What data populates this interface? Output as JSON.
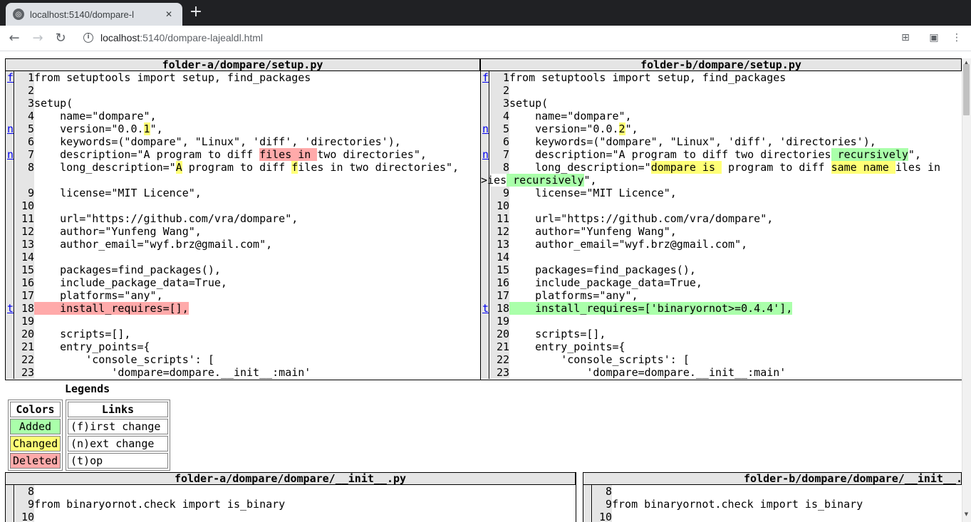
{
  "browser": {
    "tab_title": "localhost:5140/dompare-l",
    "tab_close": "✕",
    "new_tab": "+",
    "url_host": "localhost",
    "url_path": ":5140/dompare-lajealdl.html"
  },
  "diff1": {
    "left_title": "folder-a/dompare/setup.py",
    "right_title": "folder-b/dompare/setup.py",
    "left_rows": [
      {
        "lnk": "f",
        "n": "1",
        "segs": [
          {
            "t": "from setuptools import setup, find_packages"
          }
        ]
      },
      {
        "lnk": "",
        "n": "2",
        "segs": [
          {
            "t": ""
          }
        ]
      },
      {
        "lnk": "",
        "n": "3",
        "segs": [
          {
            "t": "setup("
          }
        ]
      },
      {
        "lnk": "",
        "n": "4",
        "segs": [
          {
            "t": "    name=\"dompare\","
          }
        ]
      },
      {
        "lnk": "n",
        "n": "5",
        "segs": [
          {
            "t": "    version=\"0.0."
          },
          {
            "t": "1",
            "c": "chg"
          },
          {
            "t": "\","
          }
        ]
      },
      {
        "lnk": "",
        "n": "6",
        "segs": [
          {
            "t": "    keywords=(\"dompare\", \"Linux\", 'diff', 'directories'),"
          }
        ]
      },
      {
        "lnk": "n",
        "n": "7",
        "segs": [
          {
            "t": "    description=\"A program to diff "
          },
          {
            "t": "files in ",
            "c": "del"
          },
          {
            "t": "two directories\","
          }
        ]
      },
      {
        "lnk": "",
        "n": "8",
        "segs": [
          {
            "t": "    long_description=\""
          },
          {
            "t": "A",
            "c": "chg"
          },
          {
            "t": " program to diff "
          },
          {
            "t": "f",
            "c": "chg"
          },
          {
            "t": "iles in two directories\","
          }
        ]
      },
      {
        "lnk": "",
        "n": "",
        "segs": [
          {
            "t": ""
          }
        ]
      },
      {
        "lnk": "",
        "n": "9",
        "segs": [
          {
            "t": "    license=\"MIT Licence\","
          }
        ]
      },
      {
        "lnk": "",
        "n": "10",
        "segs": [
          {
            "t": ""
          }
        ]
      },
      {
        "lnk": "",
        "n": "11",
        "segs": [
          {
            "t": "    url=\"https://github.com/vra/dompare\","
          }
        ]
      },
      {
        "lnk": "",
        "n": "12",
        "segs": [
          {
            "t": "    author=\"Yunfeng Wang\","
          }
        ]
      },
      {
        "lnk": "",
        "n": "13",
        "segs": [
          {
            "t": "    author_email=\"wyf.brz@gmail.com\","
          }
        ]
      },
      {
        "lnk": "",
        "n": "14",
        "segs": [
          {
            "t": ""
          }
        ]
      },
      {
        "lnk": "",
        "n": "15",
        "segs": [
          {
            "t": "    packages=find_packages(),"
          }
        ]
      },
      {
        "lnk": "",
        "n": "16",
        "segs": [
          {
            "t": "    include_package_data=True,"
          }
        ]
      },
      {
        "lnk": "",
        "n": "17",
        "segs": [
          {
            "t": "    platforms=\"any\","
          }
        ]
      },
      {
        "lnk": "t",
        "n": "18",
        "segs": [
          {
            "t": "    install_requires=[],",
            "c": "del"
          }
        ]
      },
      {
        "lnk": "",
        "n": "19",
        "segs": [
          {
            "t": ""
          }
        ]
      },
      {
        "lnk": "",
        "n": "20",
        "segs": [
          {
            "t": "    scripts=[],"
          }
        ]
      },
      {
        "lnk": "",
        "n": "21",
        "segs": [
          {
            "t": "    entry_points={"
          }
        ]
      },
      {
        "lnk": "",
        "n": "22",
        "segs": [
          {
            "t": "        'console_scripts': ["
          }
        ]
      },
      {
        "lnk": "",
        "n": "23",
        "segs": [
          {
            "t": "            'dompare=dompare.__init__:main'"
          }
        ]
      }
    ],
    "right_rows": [
      {
        "lnk": "f",
        "n": "1",
        "segs": [
          {
            "t": "from setuptools import setup, find_packages"
          }
        ]
      },
      {
        "lnk": "",
        "n": "2",
        "segs": [
          {
            "t": ""
          }
        ]
      },
      {
        "lnk": "",
        "n": "3",
        "segs": [
          {
            "t": "setup("
          }
        ]
      },
      {
        "lnk": "",
        "n": "4",
        "segs": [
          {
            "t": "    name=\"dompare\","
          }
        ]
      },
      {
        "lnk": "n",
        "n": "5",
        "segs": [
          {
            "t": "    version=\"0.0."
          },
          {
            "t": "2",
            "c": "chg"
          },
          {
            "t": "\","
          }
        ]
      },
      {
        "lnk": "",
        "n": "6",
        "segs": [
          {
            "t": "    keywords=(\"dompare\", \"Linux\", 'diff', 'directories'),"
          }
        ]
      },
      {
        "lnk": "n",
        "n": "7",
        "segs": [
          {
            "t": "    description=\"A program to diff two directories"
          },
          {
            "t": " recursively",
            "c": "add"
          },
          {
            "t": "\","
          }
        ]
      },
      {
        "lnk": "",
        "n": "8",
        "segs": [
          {
            "t": "    long_description=\""
          },
          {
            "t": "dompare is ",
            "c": "chg"
          },
          {
            "t": " program to diff "
          },
          {
            "t": "same name ",
            "c": "chg"
          },
          {
            "t": "iles in"
          }
        ]
      },
      {
        "lnk": "",
        "n": "",
        "wrap": true,
        "segs": [
          {
            "t": ">ies"
          },
          {
            "t": " recursively",
            "c": "add"
          },
          {
            "t": "\","
          }
        ]
      },
      {
        "lnk": "",
        "n": "9",
        "segs": [
          {
            "t": "    license=\"MIT Licence\","
          }
        ]
      },
      {
        "lnk": "",
        "n": "10",
        "segs": [
          {
            "t": ""
          }
        ]
      },
      {
        "lnk": "",
        "n": "11",
        "segs": [
          {
            "t": "    url=\"https://github.com/vra/dompare\","
          }
        ]
      },
      {
        "lnk": "",
        "n": "12",
        "segs": [
          {
            "t": "    author=\"Yunfeng Wang\","
          }
        ]
      },
      {
        "lnk": "",
        "n": "13",
        "segs": [
          {
            "t": "    author_email=\"wyf.brz@gmail.com\","
          }
        ]
      },
      {
        "lnk": "",
        "n": "14",
        "segs": [
          {
            "t": ""
          }
        ]
      },
      {
        "lnk": "",
        "n": "15",
        "segs": [
          {
            "t": "    packages=find_packages(),"
          }
        ]
      },
      {
        "lnk": "",
        "n": "16",
        "segs": [
          {
            "t": "    include_package_data=True,"
          }
        ]
      },
      {
        "lnk": "",
        "n": "17",
        "segs": [
          {
            "t": "    platforms=\"any\","
          }
        ]
      },
      {
        "lnk": "t",
        "n": "18",
        "segs": [
          {
            "t": "    install_requires=['binaryornot>=0.4.4'],",
            "c": "add"
          }
        ]
      },
      {
        "lnk": "",
        "n": "19",
        "segs": [
          {
            "t": ""
          }
        ]
      },
      {
        "lnk": "",
        "n": "20",
        "segs": [
          {
            "t": "    scripts=[],"
          }
        ]
      },
      {
        "lnk": "",
        "n": "21",
        "segs": [
          {
            "t": "    entry_points={"
          }
        ]
      },
      {
        "lnk": "",
        "n": "22",
        "segs": [
          {
            "t": "        'console_scripts': ["
          }
        ]
      },
      {
        "lnk": "",
        "n": "23",
        "segs": [
          {
            "t": "            'dompare=dompare.__init__:main'"
          }
        ]
      }
    ]
  },
  "legends": {
    "title": "Legends",
    "colors_header": "Colors",
    "added": "Added",
    "changed": "Changed",
    "deleted": "Deleted",
    "links_header": "Links",
    "first_change": "(f)irst change",
    "next_change": "(n)ext change",
    "top": "(t)op"
  },
  "diff2": {
    "left_title": "folder-a/dompare/dompare/__init__.py",
    "right_title": "folder-b/dompare/dompare/__init__.py",
    "left_rows": [
      {
        "lnk": "",
        "n": "8",
        "segs": [
          {
            "t": ""
          }
        ]
      },
      {
        "lnk": "",
        "n": "9",
        "segs": [
          {
            "t": "from binaryornot.check import is_binary"
          }
        ]
      },
      {
        "lnk": "",
        "n": "10",
        "segs": [
          {
            "t": ""
          }
        ]
      }
    ],
    "right_rows": [
      {
        "lnk": "",
        "n": "8",
        "segs": [
          {
            "t": ""
          }
        ]
      },
      {
        "lnk": "",
        "n": "9",
        "segs": [
          {
            "t": "from binaryornot.check import is_binary"
          }
        ]
      },
      {
        "lnk": "",
        "n": "10",
        "segs": [
          {
            "t": ""
          }
        ]
      }
    ]
  },
  "colors": {
    "added": "#aaffaa",
    "changed": "#ffff77",
    "deleted": "#ffaaaa",
    "header": "#e5e5e5"
  },
  "icons": {
    "back": "arrow-left-icon",
    "forward": "arrow-right-icon",
    "reload": "reload-icon",
    "info": "info-icon",
    "translate": "translate-icon",
    "clipboard": "clipboard-icon",
    "menu": "kebab-menu-icon"
  }
}
